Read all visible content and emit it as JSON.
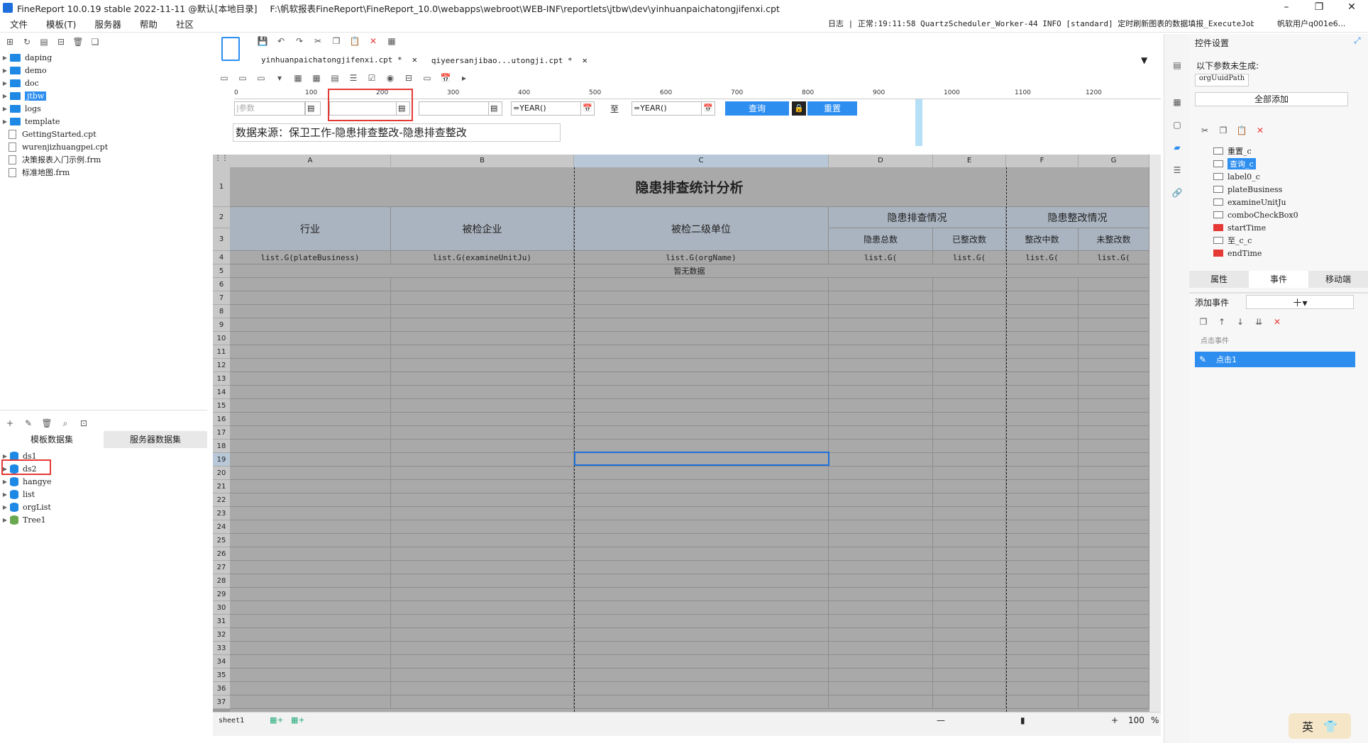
{
  "titlebar": {
    "app": "FineReport 10.0.19 stable 2022-11-11 @默认[本地目录]",
    "path": "F:\\帆软报表FineReport\\FineReport_10.0\\webapps\\webroot\\WEB-INF\\reportlets\\jtbw\\dev\\yinhuanpaichatongjifenxi.cpt"
  },
  "menu": [
    "文件",
    "模板(T)",
    "服务器",
    "帮助",
    "社区"
  ],
  "log": "日志 | 正常:19:11:58 QuartzScheduler_Worker-44 INFO [standard] 定时刷新图表的数据填报_ExecuteJob_...",
  "user": "帆软用户q001e6...",
  "tree1": [
    {
      "label": "daping",
      "type": "folder"
    },
    {
      "label": "demo",
      "type": "folder"
    },
    {
      "label": "doc",
      "type": "folder"
    },
    {
      "label": "jtbw",
      "type": "folder"
    },
    {
      "label": "logs",
      "type": "folder"
    },
    {
      "label": "template",
      "type": "folder"
    },
    {
      "label": "GettingStarted.cpt",
      "type": "file"
    },
    {
      "label": "wurenjizhuangpei.cpt",
      "type": "file"
    },
    {
      "label": "决策报表入门示例.frm",
      "type": "file"
    },
    {
      "label": "标准地图.frm",
      "type": "file"
    }
  ],
  "dstabs": [
    "模板数据集",
    "服务器数据集"
  ],
  "tree2": [
    "ds1",
    "ds2",
    "hangye",
    "list",
    "orgList",
    "Tree1"
  ],
  "tabs": [
    {
      "label": "yinhuanpaichatongjifenxi.cpt *"
    },
    {
      "label": "qiyeersanjibao...utongji.cpt *"
    }
  ],
  "ruler": [
    "0",
    "100",
    "200",
    "300",
    "400",
    "500",
    "600",
    "700",
    "800",
    "900",
    "1000",
    "1100",
    "1200"
  ],
  "params": {
    "ph1": "|参数",
    "year1": "=YEAR()",
    "zhi": "至",
    "year2": "=YEAR()",
    "query": "查询",
    "reset": "重置",
    "source": "数据来源：保卫工作-隐患排查整改-隐患排查整改"
  },
  "columns": [
    "A",
    "B",
    "C",
    "D",
    "E",
    "F",
    "G"
  ],
  "rows": [
    "1",
    "2",
    "3",
    "4",
    "5",
    "6",
    "7",
    "8",
    "9",
    "10",
    "11",
    "12",
    "13",
    "14",
    "15",
    "16",
    "17",
    "18",
    "19",
    "20",
    "21",
    "22",
    "23",
    "24",
    "25",
    "26",
    "27",
    "28",
    "29",
    "30",
    "31",
    "32",
    "33",
    "34",
    "35",
    "36",
    "37"
  ],
  "report": {
    "title": "隐患排查统计分析",
    "h_industry": "行业",
    "h_company": "被检企业",
    "h_unit": "被检二级单位",
    "h_check": "隐患排查情况",
    "h_rect": "隐患整改情况",
    "h_total": "隐患总数",
    "h_done": "已整改数",
    "h_doing": "整改中数",
    "h_undone": "未整改数",
    "f_a": "list.G(plateBusiness)",
    "f_b": "list.G(examineUnitJu)",
    "f_c": "list.G(orgName)",
    "f_d": "list.G(",
    "f_e": "list.G(",
    "f_f": "list.G(",
    "f_g": "list.G(",
    "nodata": "暂无数据"
  },
  "bottom": {
    "sheet": "sheet1",
    "zoom": "100",
    "pct": "%"
  },
  "right": {
    "title": "控件设置",
    "note": "以下参数未生成:",
    "param": "orgUuidPath",
    "addall": "全部添加",
    "widgets": [
      "重置_c",
      "查询_c",
      "label0_c",
      "plateBusiness",
      "examineUnitJu",
      "comboCheckBox0",
      "startTime",
      "至_c_c",
      "endTime"
    ],
    "tabs": [
      "属性",
      "事件",
      "移动端"
    ],
    "addevent": "添加事件",
    "evthead": "点击事件",
    "evt": "点击1"
  },
  "ime": "英"
}
